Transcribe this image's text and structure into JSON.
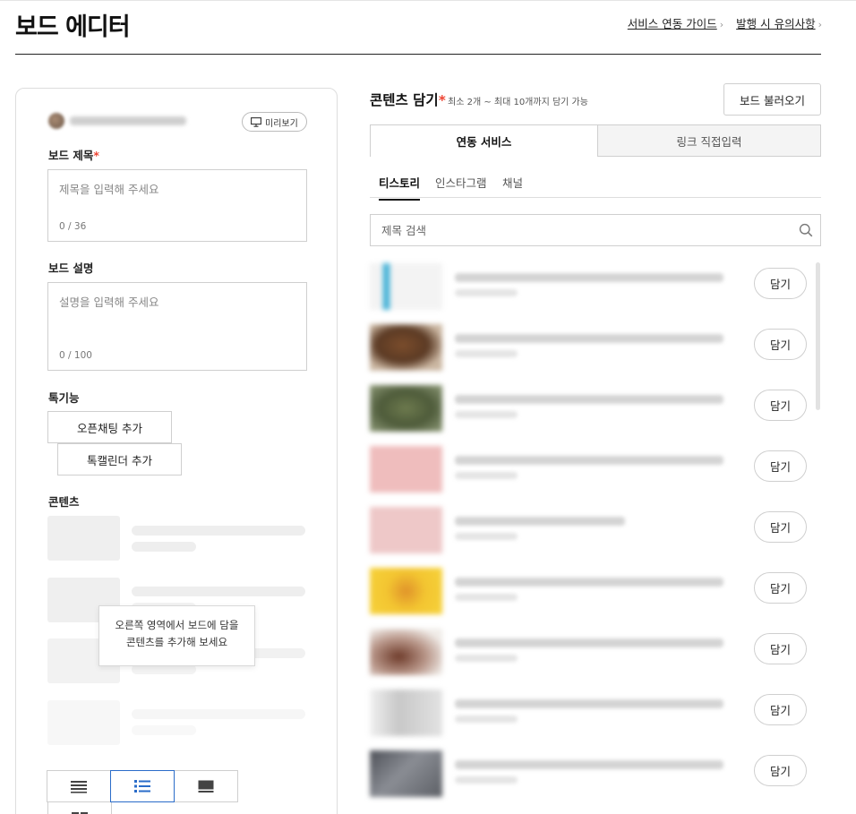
{
  "header": {
    "title": "보드 에디터",
    "links": [
      {
        "label": "서비스 연동 가이드"
      },
      {
        "label": "발행 시 유의사항"
      }
    ]
  },
  "editor": {
    "preview_label": "미리보기",
    "board_title": {
      "label": "보드 제목",
      "required_mark": "*",
      "placeholder": "제목을 입력해 주세요",
      "count": "0 / 36"
    },
    "board_desc": {
      "label": "보드 설명",
      "placeholder": "설명을 입력해 주세요",
      "count": "0 / 100"
    },
    "features_label": "톡기능",
    "feature_buttons": [
      "오픈채팅 추가",
      "톡캘린더 추가"
    ],
    "contents_label": "콘텐츠",
    "empty_hint_line1": "오른쪽 영역에서 보드에 담을",
    "empty_hint_line2": "콘텐츠를 추가해 보세요"
  },
  "picker": {
    "title": "콘텐츠 담기",
    "required_mark": "*",
    "subtitle": "최소 2개 ~ 최대 10개까지 담기 가능",
    "load_button": "보드 불러오기",
    "tabs": [
      "연동 서비스",
      "링크 직접입력"
    ],
    "active_tab": 0,
    "subtabs": [
      "티스토리",
      "인스타그램",
      "채널"
    ],
    "active_subtab": 0,
    "search_placeholder": "제목 검색",
    "add_label": "담기",
    "items_count": 9
  },
  "colors": {
    "required": "#e43",
    "active_view_border": "#2a6cc9",
    "thumb_palette": [
      "#e9eef2",
      "#6b4a32",
      "#5f7048",
      "#e8b9b9",
      "#e9c4c4",
      "#f2c12e",
      "#c9b8ad",
      "#d8d8d8",
      "#6b6e74"
    ]
  },
  "icons": {
    "preview": "monitor-icon",
    "search": "search-icon",
    "view_modes": [
      "list-compact-icon",
      "list-bullet-icon",
      "card-icon",
      "grid-icon"
    ]
  }
}
